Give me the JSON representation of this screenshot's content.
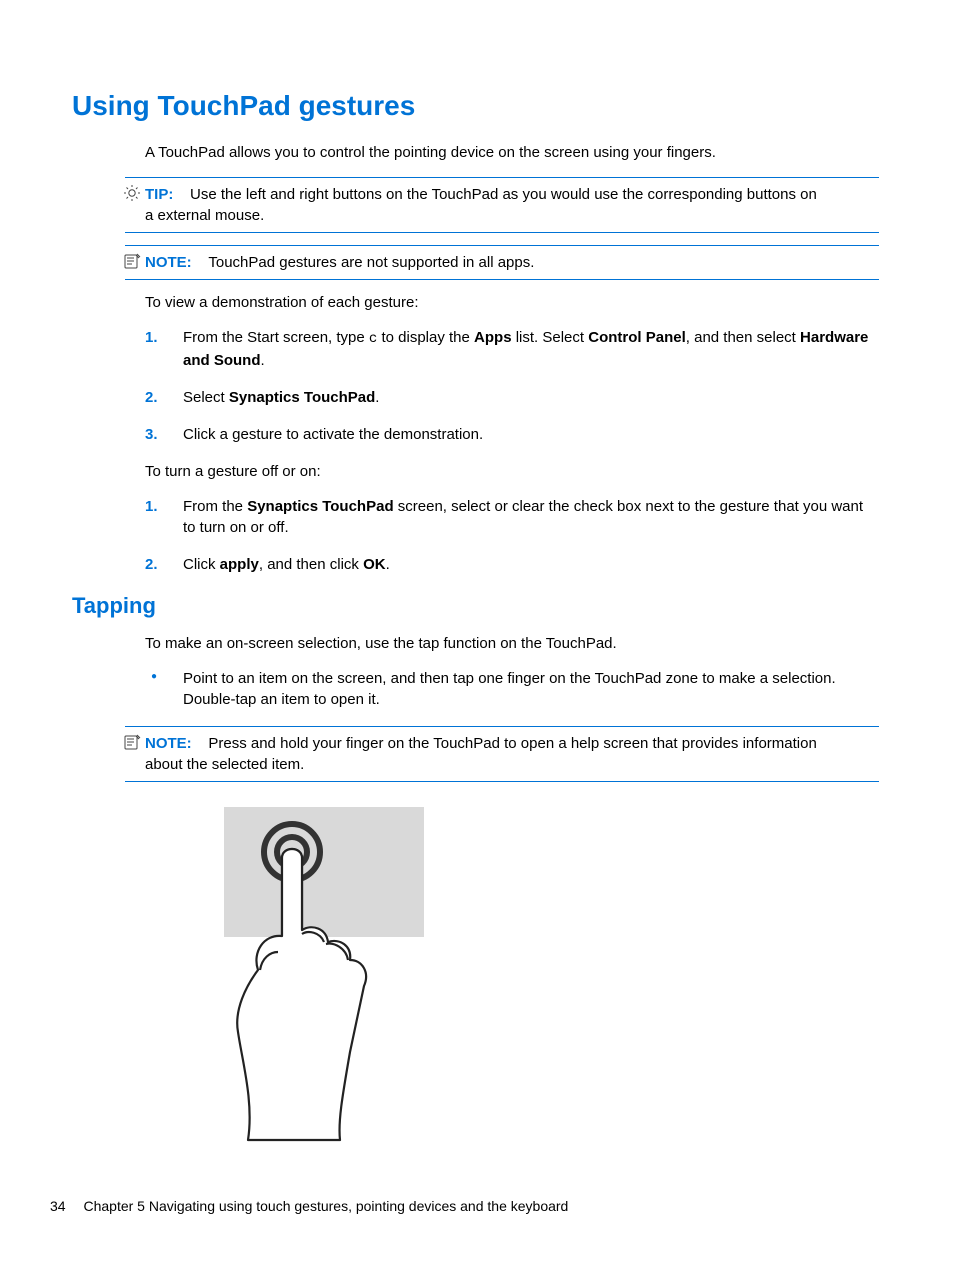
{
  "heading1": "Using TouchPad gestures",
  "intro": "A TouchPad allows you to control the pointing device on the screen using your fingers.",
  "tip": {
    "label": "TIP:",
    "text_line1": "Use the left and right buttons on the TouchPad as you would use the corresponding buttons on",
    "text_line2": "a external mouse."
  },
  "note1": {
    "label": "NOTE:",
    "text": "TouchPad gestures are not supported in all apps."
  },
  "demo_intro": "To view a demonstration of each gesture:",
  "demo_steps": {
    "s1_a": "From the Start screen, type ",
    "s1_c": "c",
    "s1_b": " to display the ",
    "s1_apps": "Apps",
    "s1_c2": " list. Select ",
    "s1_cp": "Control Panel",
    "s1_d": ", and then select ",
    "s1_hs": "Hardware and Sound",
    "s1_end": ".",
    "s2_a": "Select ",
    "s2_syn": "Synaptics TouchPad",
    "s2_end": ".",
    "s3": "Click a gesture to activate the demonstration."
  },
  "toggle_intro": "To turn a gesture off or on:",
  "toggle_steps": {
    "s1_a": "From the ",
    "s1_syn": "Synaptics TouchPad",
    "s1_b": " screen, select or clear the check box next to the gesture that you want to turn on or off.",
    "s2_a": "Click ",
    "s2_apply": "apply",
    "s2_b": ", and then click ",
    "s2_ok": "OK",
    "s2_end": "."
  },
  "heading2": "Tapping",
  "tapping_intro": "To make an on-screen selection, use the tap function on the TouchPad.",
  "tapping_bullet": "Point to an item on the screen, and then tap one finger on the TouchPad zone to make a selection. Double-tap an item to open it.",
  "note2": {
    "label": "NOTE:",
    "text_line1": "Press and hold your finger on the TouchPad to open a help screen that provides information",
    "text_line2": "about the selected item."
  },
  "footer": {
    "page": "34",
    "chapter": "Chapter 5   Navigating using touch gestures, pointing devices and the keyboard"
  },
  "nums": {
    "n1": "1.",
    "n2": "2.",
    "n3": "3."
  }
}
